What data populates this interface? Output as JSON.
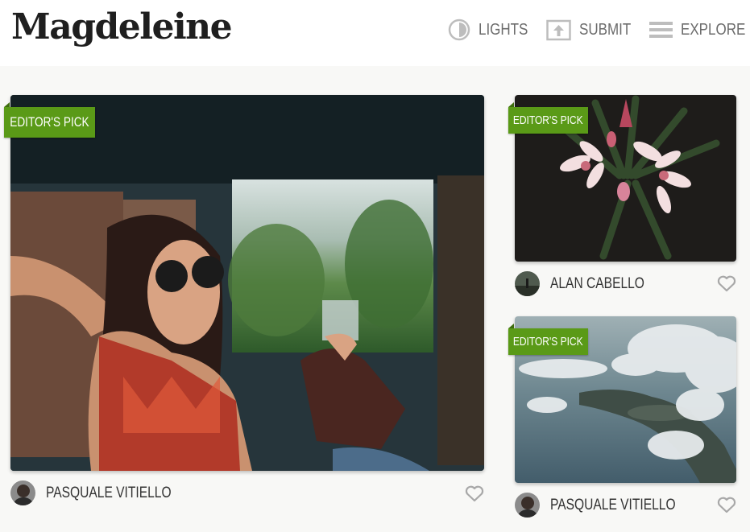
{
  "brand": {
    "logo": "Magdeleine"
  },
  "nav": {
    "lights": {
      "label": "LIGHTS",
      "icon": "contrast-icon"
    },
    "submit": {
      "label": "SUBMIT",
      "icon": "upload-icon"
    },
    "explore": {
      "label": "EXPLORE",
      "icon": "menu-icon"
    }
  },
  "colors": {
    "accent": "#5a9a17",
    "text": "#333333",
    "nav": "#6b6b6b"
  },
  "photos": [
    {
      "badge": "EDITOR'S PICK",
      "author": "PASQUALE VITIELLO",
      "subject": "woman-in-car"
    },
    {
      "badge": "EDITOR'S PICK",
      "author": "ALAN CABELLO",
      "subject": "pink-flowers"
    },
    {
      "badge": "EDITOR'S PICK",
      "author": "PASQUALE VITIELLO",
      "subject": "aerial-coast-clouds"
    }
  ]
}
